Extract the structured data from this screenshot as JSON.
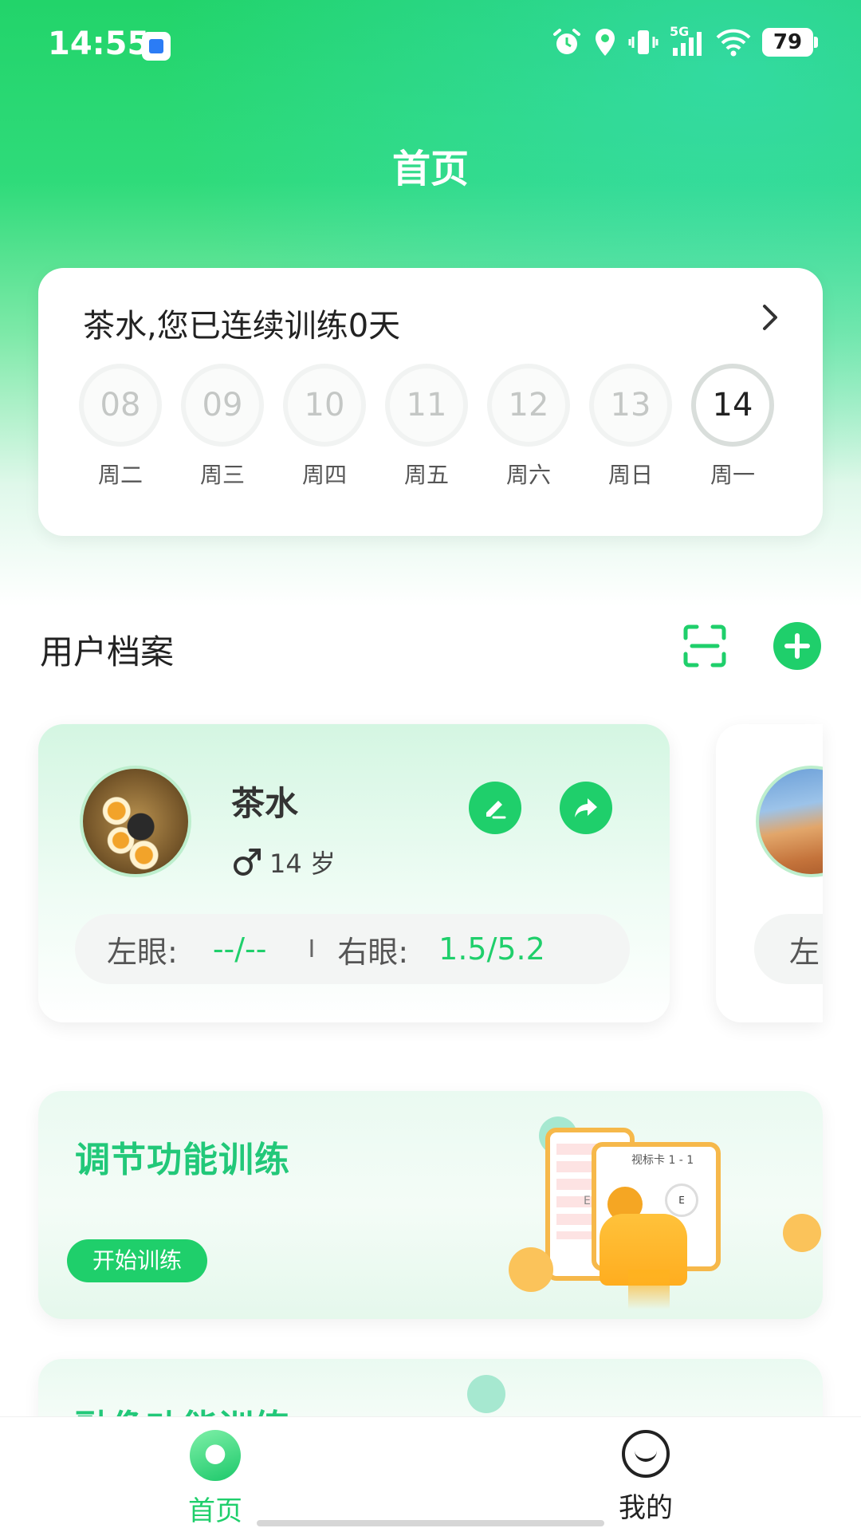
{
  "status_bar": {
    "time": "14:55",
    "network_label": "5G",
    "battery": "79"
  },
  "header": {
    "title": "首页"
  },
  "streak": {
    "message": "茶水,您已连续训练0天",
    "days": [
      {
        "date": "08",
        "weekday": "周二"
      },
      {
        "date": "09",
        "weekday": "周三"
      },
      {
        "date": "10",
        "weekday": "周四"
      },
      {
        "date": "11",
        "weekday": "周五"
      },
      {
        "date": "12",
        "weekday": "周六"
      },
      {
        "date": "13",
        "weekday": "周日"
      },
      {
        "date": "14",
        "weekday": "周一"
      }
    ]
  },
  "profiles": {
    "section_title": "用户档案",
    "cards": [
      {
        "name": "茶水",
        "gender_symbol": "♂",
        "age": "14 岁",
        "left_eye_label": "左眼:",
        "left_eye_value": "--/--",
        "divider": "I",
        "right_eye_label": "右眼:",
        "right_eye_value": "1.5/5.2"
      },
      {
        "left_eye_label_partial": "左"
      }
    ]
  },
  "training": [
    {
      "title": "调节功能训练",
      "button": "开始训练",
      "illustration_text": "视标卡 1 - 1",
      "illustration_letter": "E"
    },
    {
      "title": "融像功能训练"
    }
  ],
  "bottom_nav": {
    "items": [
      {
        "label": "首页",
        "active": true
      },
      {
        "label": "我的",
        "active": false
      }
    ]
  },
  "colors": {
    "accent": "#1fcf6b",
    "accent_text": "#22c879"
  }
}
